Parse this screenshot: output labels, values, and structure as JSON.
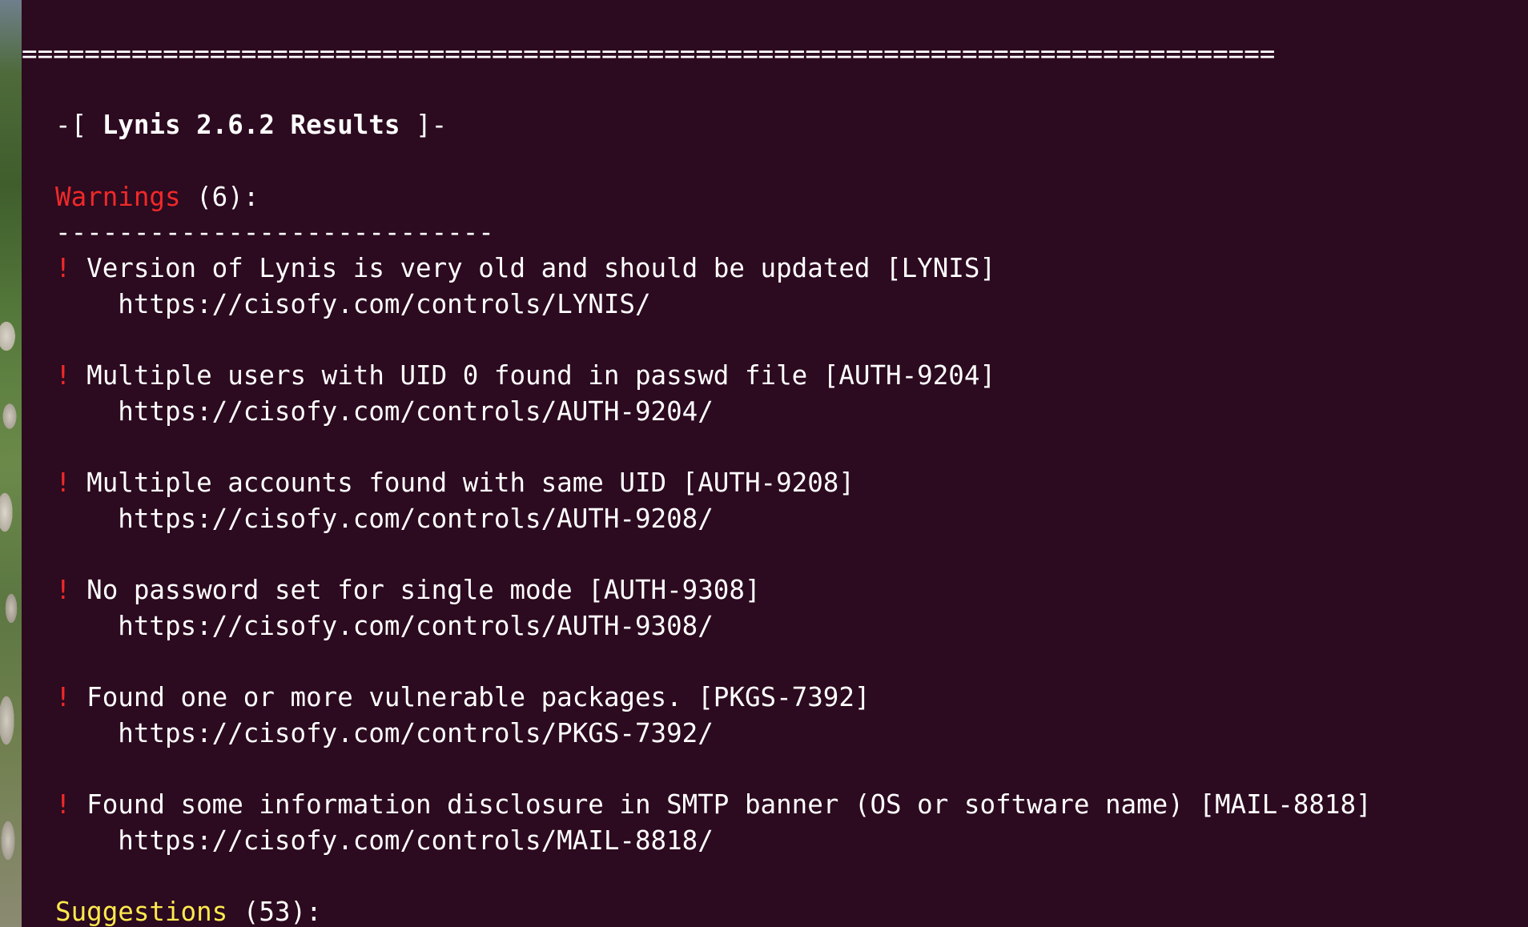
{
  "terminal": {
    "separator": "================================================================================",
    "results_title_prefix": "-[ ",
    "results_title": "Lynis 2.6.2 Results",
    "results_title_suffix": " ]-",
    "warnings_label": "Warnings",
    "warnings_count": " (6):",
    "warnings_divider": "----------------------------",
    "warning_marker": "!",
    "warnings": [
      {
        "text": " Version of Lynis is very old and should be updated [LYNIS]",
        "url": "    https://cisofy.com/controls/LYNIS/"
      },
      {
        "text": " Multiple users with UID 0 found in passwd file [AUTH-9204]",
        "url": "    https://cisofy.com/controls/AUTH-9204/"
      },
      {
        "text": " Multiple accounts found with same UID [AUTH-9208]",
        "url": "    https://cisofy.com/controls/AUTH-9208/"
      },
      {
        "text": " No password set for single mode [AUTH-9308]",
        "url": "    https://cisofy.com/controls/AUTH-9308/"
      },
      {
        "text": " Found one or more vulnerable packages. [PKGS-7392]",
        "url": "    https://cisofy.com/controls/PKGS-7392/"
      },
      {
        "text": " Found some information disclosure in SMTP banner (OS or software name) [MAIL-8818]",
        "url": "    https://cisofy.com/controls/MAIL-8818/"
      }
    ],
    "suggestions_label": "Suggestions",
    "suggestions_count": " (53):"
  },
  "colors": {
    "background": "#2c0a1f",
    "text": "#ffffff",
    "warning": "#ef2929",
    "suggestion": "#fce94f"
  }
}
